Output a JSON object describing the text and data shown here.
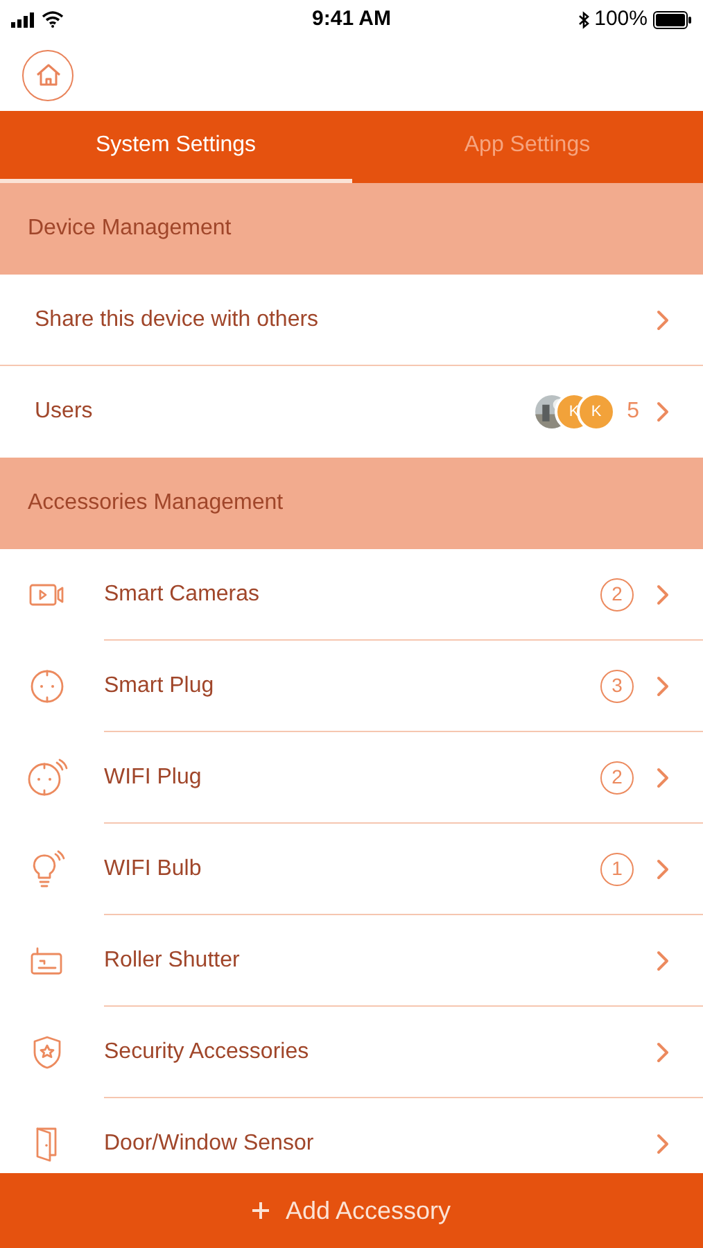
{
  "status_bar": {
    "time": "9:41 AM",
    "battery": "100%"
  },
  "tabs": [
    {
      "label": "System Settings",
      "selected": true
    },
    {
      "label": "App Settings",
      "selected": false
    }
  ],
  "sections": [
    {
      "title": "Device Management",
      "items": [
        {
          "kind": "plain",
          "label": "Share this device with others"
        },
        {
          "kind": "users",
          "label": "Users",
          "avatars": [
            {
              "kind": "picture"
            },
            {
              "kind": "letter",
              "letter": "K"
            },
            {
              "kind": "letter",
              "letter": "K"
            }
          ],
          "count": "5"
        }
      ]
    },
    {
      "title": "Accessories Management",
      "items": [
        {
          "kind": "camera",
          "label": "Smart Cameras",
          "count": "2"
        },
        {
          "kind": "plug",
          "label": "Smart Plug",
          "count": "3"
        },
        {
          "kind": "wifi-plug",
          "label": "WIFI Plug",
          "count": "2"
        },
        {
          "kind": "bulb",
          "label": "WIFI Bulb",
          "count": "1"
        },
        {
          "kind": "shutter",
          "label": "Roller Shutter"
        },
        {
          "kind": "shield",
          "label": "Security Accessories"
        },
        {
          "kind": "door",
          "label": "Door/Window Sensor"
        }
      ]
    }
  ],
  "add_button": {
    "label": "Add Accessory"
  }
}
